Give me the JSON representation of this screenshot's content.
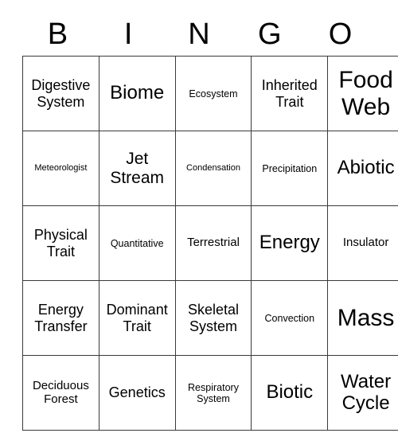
{
  "card": {
    "title_letters": [
      "B",
      "I",
      "N",
      "G",
      "O"
    ],
    "rows": [
      [
        {
          "label": "Digestive System",
          "size": "fs-l"
        },
        {
          "label": "Biome",
          "size": "fs-xxl"
        },
        {
          "label": "Ecosystem",
          "size": "fs-s"
        },
        {
          "label": "Inherited Trait",
          "size": "fs-l"
        },
        {
          "label": "Food Web",
          "size": "fs-huge"
        }
      ],
      [
        {
          "label": "Meteorologist",
          "size": "fs-xs"
        },
        {
          "label": "Jet Stream",
          "size": "fs-xl"
        },
        {
          "label": "Condensation",
          "size": "fs-xs"
        },
        {
          "label": "Precipitation",
          "size": "fs-s"
        },
        {
          "label": "Abiotic",
          "size": "fs-xxl"
        }
      ],
      [
        {
          "label": "Physical Trait",
          "size": "fs-l"
        },
        {
          "label": "Quantitative",
          "size": "fs-s"
        },
        {
          "label": "Terrestrial",
          "size": "fs-m"
        },
        {
          "label": "Energy",
          "size": "fs-xxl"
        },
        {
          "label": "Insulator",
          "size": "fs-m"
        }
      ],
      [
        {
          "label": "Energy Transfer",
          "size": "fs-l"
        },
        {
          "label": "Dominant Trait",
          "size": "fs-l"
        },
        {
          "label": "Skeletal System",
          "size": "fs-l"
        },
        {
          "label": "Convection",
          "size": "fs-s"
        },
        {
          "label": "Mass",
          "size": "fs-huge"
        }
      ],
      [
        {
          "label": "Deciduous Forest",
          "size": "fs-m"
        },
        {
          "label": "Genetics",
          "size": "fs-l"
        },
        {
          "label": "Respiratory System",
          "size": "fs-s"
        },
        {
          "label": "Biotic",
          "size": "fs-xxl"
        },
        {
          "label": "Water Cycle",
          "size": "fs-xxl"
        }
      ]
    ]
  },
  "colors": {
    "border": "#3a3a3a",
    "text": "#000000",
    "background": "#ffffff"
  }
}
